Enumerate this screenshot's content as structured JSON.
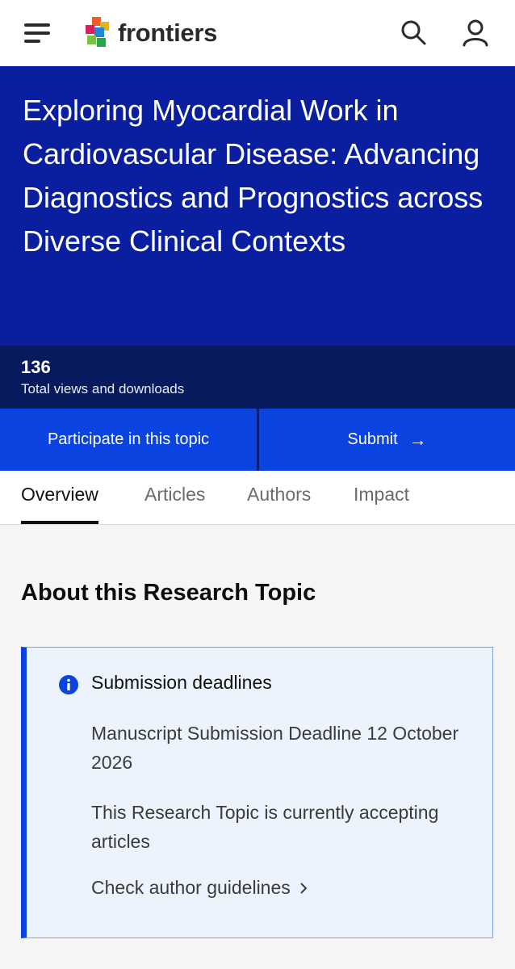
{
  "header": {
    "logo_text": "frontiers",
    "icons": {
      "menu": "hamburger-menu-icon",
      "logo": "frontiers-logo-icon",
      "search": "search-icon",
      "account": "user-icon"
    }
  },
  "hero": {
    "title": "Exploring Myocardial Work in Cardiovascular Disease: Advancing Diagnostics and Prognostics across Diverse Clinical Contexts"
  },
  "stats": {
    "value": "136",
    "label": "Total views and downloads"
  },
  "cta": {
    "participate_label": "Participate in this topic",
    "submit_label": "Submit",
    "submit_icon": "arrow-right-icon"
  },
  "tabs": [
    {
      "label": "Overview",
      "active": true
    },
    {
      "label": "Articles",
      "active": false
    },
    {
      "label": "Authors",
      "active": false
    },
    {
      "label": "Impact",
      "active": false
    }
  ],
  "about": {
    "section_title": "About this Research Topic",
    "card": {
      "icon": "info-icon",
      "heading": "Submission deadlines",
      "deadline_text": "Manuscript Submission Deadline 12 October 2026",
      "status_text": "This Research Topic is currently accepting articles",
      "link_label": "Check author guidelines",
      "link_icon": "chevron-right-icon"
    }
  },
  "colors": {
    "hero_bg": "#0a1fa0",
    "stats_bg": "#071a5e",
    "cta_bg": "#0a43e0",
    "card_bg": "#edf3fc",
    "card_accent": "#0a43e0"
  }
}
